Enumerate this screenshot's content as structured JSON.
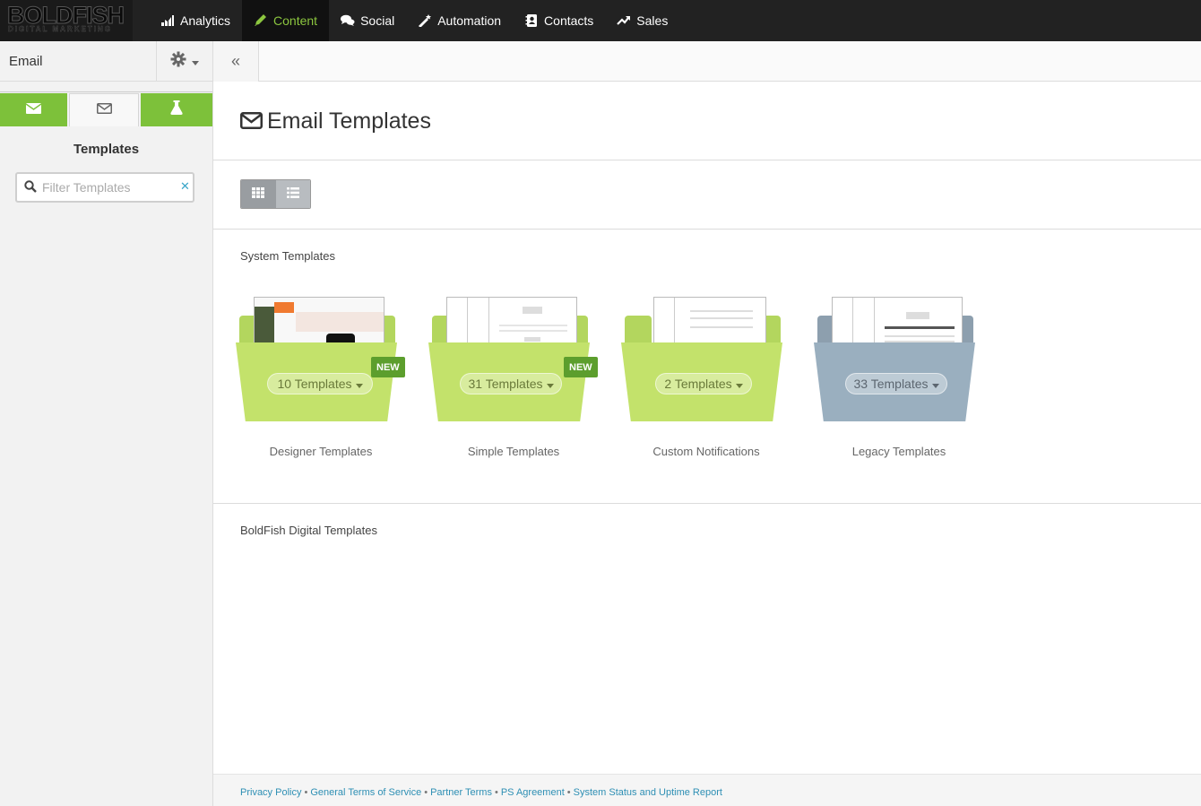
{
  "app": {
    "logo_main": "BOLDFISH",
    "logo_sub": "DIGITAL MARKETING"
  },
  "nav": {
    "items": [
      {
        "label": "Analytics",
        "icon": "chart-icon"
      },
      {
        "label": "Content",
        "icon": "pencil-icon",
        "active": true
      },
      {
        "label": "Social",
        "icon": "comments-icon"
      },
      {
        "label": "Automation",
        "icon": "magic-wand-icon"
      },
      {
        "label": "Contacts",
        "icon": "address-book-icon"
      },
      {
        "label": "Sales",
        "icon": "trend-up-icon"
      }
    ]
  },
  "sidebar": {
    "title": "Email",
    "section_title": "Templates",
    "filter_placeholder": "Filter Templates"
  },
  "main": {
    "page_title": "Email Templates",
    "system_section": "System Templates",
    "boldfish_section": "BoldFish Digital Templates",
    "folders": [
      {
        "name": "Designer Templates",
        "count_label": "10 Templates",
        "badge": "NEW",
        "color": "#c3e26b"
      },
      {
        "name": "Simple Templates",
        "count_label": "31 Templates",
        "badge": "NEW",
        "color": "#c3e26b"
      },
      {
        "name": "Custom Notifications",
        "count_label": "2 Templates",
        "color": "#c3e26b"
      },
      {
        "name": "Legacy Templates",
        "count_label": "33 Templates",
        "color": "#9aafbf"
      }
    ]
  },
  "footer": {
    "links": [
      "Privacy Policy",
      "General Terms of Service",
      "Partner Terms",
      "PS Agreement",
      "System Status and Uptime Report"
    ],
    "separator": "•"
  },
  "colors": {
    "accent_green": "#8cc63f",
    "tab_green": "#7dc13a",
    "badge_green": "#5c9e2d",
    "link_blue": "#2e8fb4"
  }
}
